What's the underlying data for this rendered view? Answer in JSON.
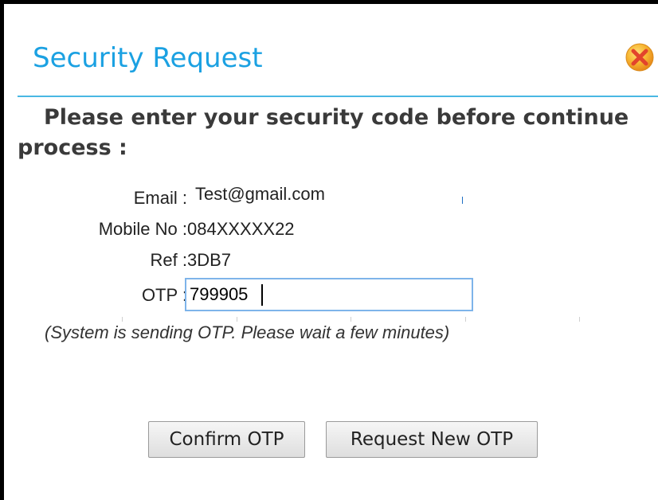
{
  "dialog": {
    "title": "Security Request",
    "close_icon": "close-icon",
    "accent_color": "#1ba1e2",
    "close_icon_color": "#f5a623"
  },
  "instruction": "Please enter your security code before continue process :",
  "form": {
    "email": {
      "label": "Email :",
      "value": "Test@gmail.com"
    },
    "mobile": {
      "label": "Mobile No :",
      "value": "084XXXXX22"
    },
    "ref": {
      "label": "Ref :",
      "value": "3DB7"
    },
    "otp": {
      "label": "OTP :",
      "value": "799905"
    }
  },
  "status_note": "(System is sending OTP. Please wait a few minutes)",
  "buttons": {
    "confirm": "Confirm OTP",
    "request_new": "Request New OTP"
  }
}
